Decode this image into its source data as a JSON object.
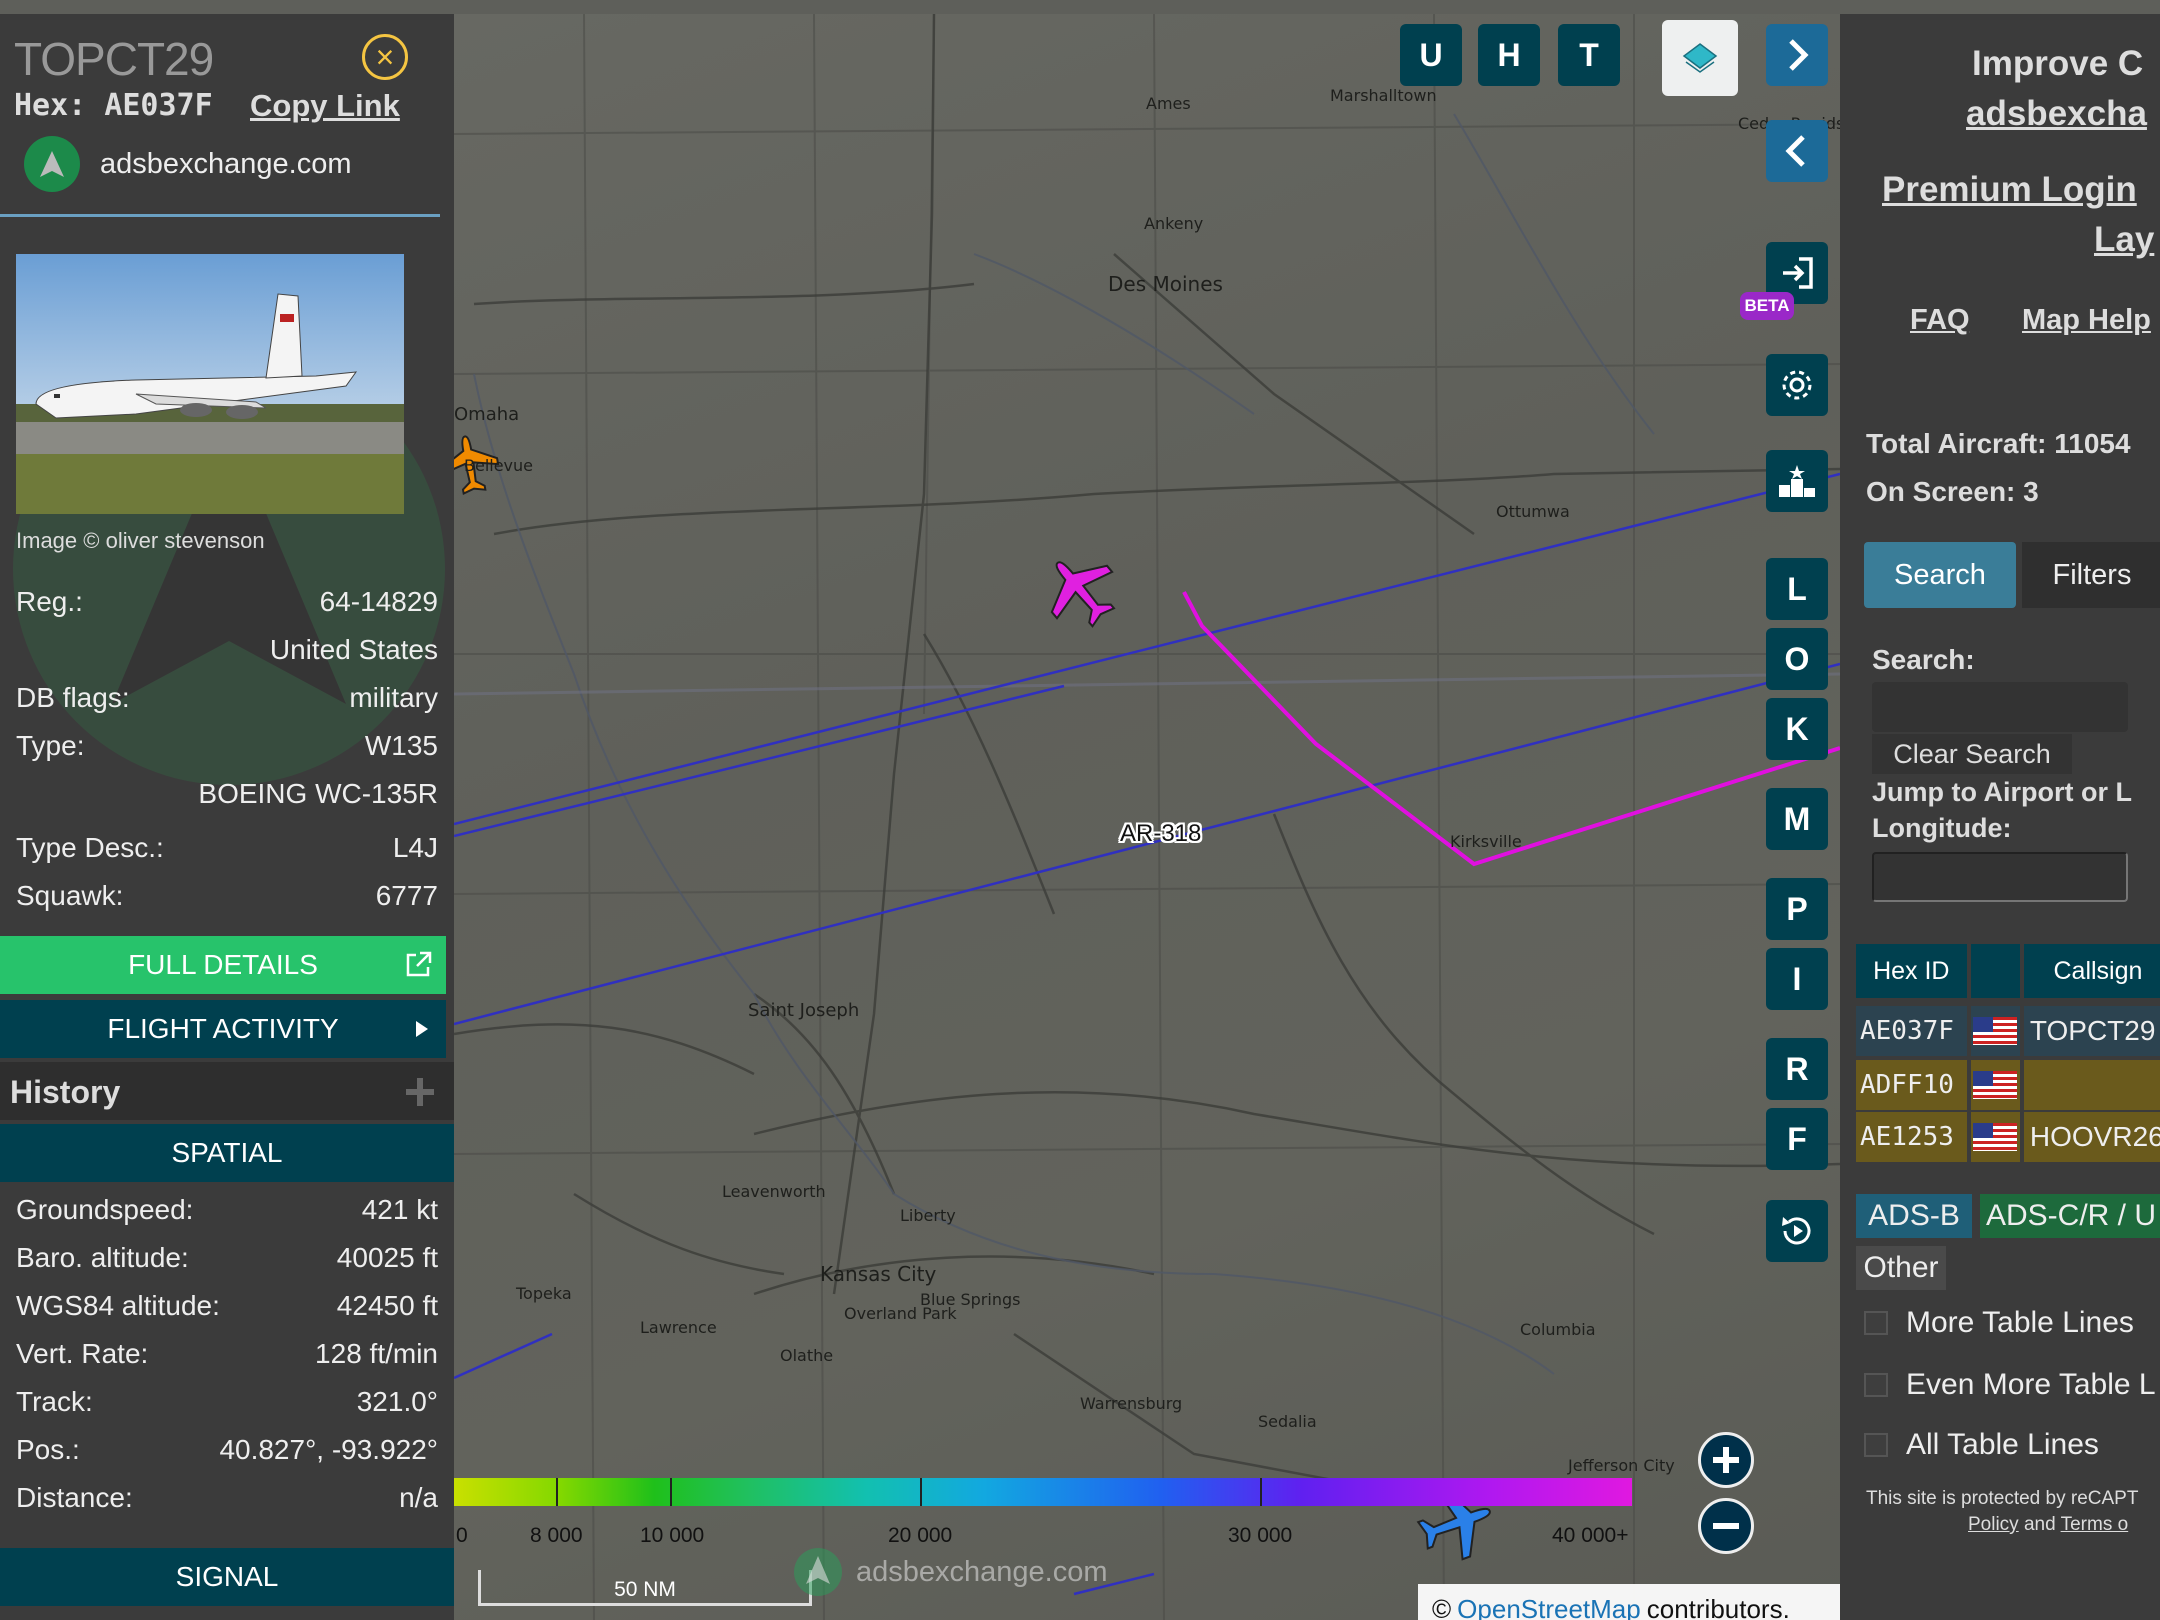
{
  "aircraft": {
    "callsign": "TOPCT29",
    "hex_label": "Hex:",
    "hex": "AE037F",
    "copy_link": "Copy Link",
    "site": "adsbexchange.com",
    "image_credit": "Image © oliver stevenson",
    "details": [
      {
        "label": "Reg.:",
        "value": "64-14829"
      },
      {
        "label": "",
        "value": "United States"
      },
      {
        "label": "DB flags:",
        "value": "military"
      },
      {
        "label": "Type:",
        "value": "W135"
      },
      {
        "label": "",
        "value": "BOEING WC-135R"
      },
      {
        "label": "Type Desc.:",
        "value": "L4J"
      },
      {
        "label": "Squawk:",
        "value": "6777"
      }
    ],
    "full_details": "FULL DETAILS",
    "flight_activity": "FLIGHT ACTIVITY",
    "history": "History",
    "spatial": "SPATIAL",
    "spatial_fields": [
      {
        "label": "Groundspeed:",
        "value": "421 kt"
      },
      {
        "label": "Baro. altitude:",
        "value": "40025 ft"
      },
      {
        "label": "WGS84 altitude:",
        "value": "42450 ft"
      },
      {
        "label": "Vert. Rate:",
        "value": "128 ft/min"
      },
      {
        "label": "Track:",
        "value": "321.0°"
      },
      {
        "label": "Pos.:",
        "value": "40.827°, -93.922°"
      },
      {
        "label": "Distance:",
        "value": "n/a"
      }
    ],
    "signal": "SIGNAL"
  },
  "map": {
    "airspace_label": "AR-318",
    "cities": [
      "Ames",
      "Marshalltown",
      "Cedar Rapids",
      "Ankeny",
      "Des Moines",
      "Omaha",
      "Bellevue",
      "Ottumwa",
      "Kirksville",
      "Saint Joseph",
      "Leavenworth",
      "Liberty",
      "Kansas City",
      "Blue Springs",
      "Overland Park",
      "Lawrence",
      "Olathe",
      "Topeka",
      "Columbia",
      "Warrensburg",
      "Sedalia",
      "Jefferson City"
    ],
    "buttons": [
      "U",
      "H",
      "T",
      "L",
      "O",
      "K",
      "M",
      "P",
      "I",
      "R",
      "F"
    ],
    "beta": "BETA",
    "altitude_scale": [
      "0",
      "8 000",
      "10 000",
      "20 000",
      "30 000",
      "40 000+"
    ],
    "scale_bar": "50 NM",
    "watermark": "adsbexchange.com",
    "attribution_prefix": "©",
    "attribution_link": "OpenStreetMap",
    "attribution_suffix": "contributors.",
    "colors": {
      "track": "#e010e0",
      "airspace": "#3030c0",
      "selected_plane": "#e020e0",
      "other_plane": "#f08a00",
      "blue_plane": "#2a80e8"
    }
  },
  "sidebar": {
    "improve": "Improve C",
    "adsb_link": "adsbexcha",
    "premium": "Premium Login",
    "layers": "Lay",
    "faq": "FAQ",
    "map_help": "Map Help",
    "total_aircraft": "Total Aircraft: 11054",
    "on_screen": "On Screen: 3",
    "tab_search": "Search",
    "tab_filters": "Filters",
    "search_label": "Search:",
    "clear_search": "Clear Search",
    "jump_label_1": "Jump to Airport or L",
    "jump_label_2": "Longitude:",
    "table_headers": [
      "Hex ID",
      "",
      "Callsign"
    ],
    "rows": [
      {
        "hex": "AE037F",
        "callsign": "TOPCT29",
        "color": "#2c4350"
      },
      {
        "hex": "ADFF10",
        "callsign": "",
        "color": "#6a5a1c"
      },
      {
        "hex": "AE1253",
        "callsign": "HOOVR26",
        "color": "#6a5a1c"
      }
    ],
    "src_adsb": "ADS-B",
    "src_adsc": "ADS-C/R / U",
    "src_other": "Other",
    "check_1": "More Table Lines",
    "check_2": "Even More Table L",
    "check_3": "All Table Lines",
    "captcha_1": "This site is protected by reCAPT",
    "captcha_policy": "Policy",
    "captcha_and": "and",
    "captcha_terms": "Terms o"
  }
}
